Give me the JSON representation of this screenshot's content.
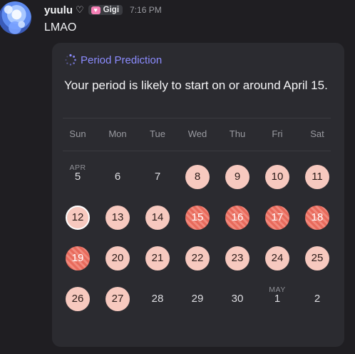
{
  "message": {
    "username": "yuulu",
    "username_icon": "heart-outline",
    "role_tag": "Gigi",
    "timestamp": "7:16 PM",
    "text": "LMAO"
  },
  "card": {
    "title": "Period Prediction",
    "prediction": "Your period is likely to start on or around April 15."
  },
  "calendar": {
    "weekdays": [
      "Sun",
      "Mon",
      "Tue",
      "Wed",
      "Thu",
      "Fri",
      "Sat"
    ],
    "month_labels": [
      {
        "label": "APR",
        "week": 0,
        "col": 0
      },
      {
        "label": "MAY",
        "week": 3,
        "col": 5
      }
    ],
    "weeks": [
      [
        {
          "d": "5",
          "s": "none"
        },
        {
          "d": "6",
          "s": "none"
        },
        {
          "d": "7",
          "s": "none"
        },
        {
          "d": "8",
          "s": "predicted"
        },
        {
          "d": "9",
          "s": "predicted"
        },
        {
          "d": "10",
          "s": "predicted"
        },
        {
          "d": "11",
          "s": "predicted"
        }
      ],
      [
        {
          "d": "12",
          "s": "today"
        },
        {
          "d": "13",
          "s": "predicted"
        },
        {
          "d": "14",
          "s": "predicted"
        },
        {
          "d": "15",
          "s": "period"
        },
        {
          "d": "16",
          "s": "period"
        },
        {
          "d": "17",
          "s": "period"
        },
        {
          "d": "18",
          "s": "period"
        }
      ],
      [
        {
          "d": "19",
          "s": "period"
        },
        {
          "d": "20",
          "s": "predicted"
        },
        {
          "d": "21",
          "s": "predicted"
        },
        {
          "d": "22",
          "s": "predicted"
        },
        {
          "d": "23",
          "s": "predicted"
        },
        {
          "d": "24",
          "s": "predicted"
        },
        {
          "d": "25",
          "s": "predicted"
        }
      ],
      [
        {
          "d": "26",
          "s": "predicted"
        },
        {
          "d": "27",
          "s": "predicted"
        },
        {
          "d": "28",
          "s": "none"
        },
        {
          "d": "29",
          "s": "none"
        },
        {
          "d": "30",
          "s": "none"
        },
        {
          "d": "1",
          "s": "none"
        },
        {
          "d": "2",
          "s": "none"
        }
      ]
    ]
  },
  "colors": {
    "predicted": "#f7c9bf",
    "period": "#e86a5c",
    "accent": "#8c8cff",
    "background": "#1f1e22",
    "card": "#2b2b30"
  }
}
